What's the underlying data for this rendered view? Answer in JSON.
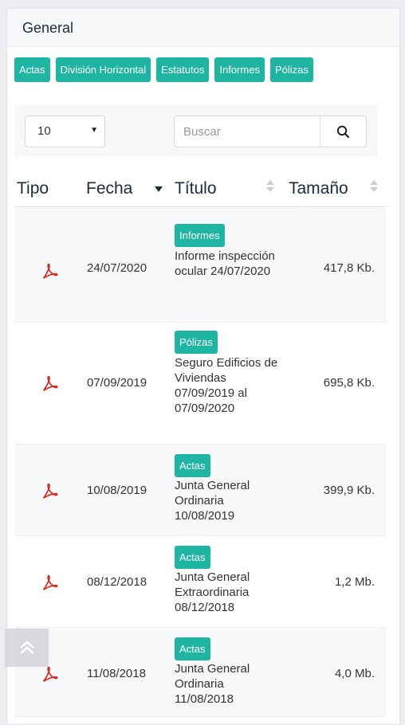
{
  "panel": {
    "title": "General"
  },
  "tags": [
    "Actas",
    "División Horizontal",
    "Estatutos",
    "Informes",
    "Pólizas"
  ],
  "toolbar": {
    "page_size": "10",
    "search_placeholder": "Buscar"
  },
  "table": {
    "columns": [
      "Tipo",
      "Fecha",
      "Título",
      "Tamaño"
    ],
    "rows": [
      {
        "type": "pdf-icon",
        "date": "24/07/2020",
        "badge": "Informes",
        "title": "Informe inspección ocular 24/07/2020",
        "size": "417,8 Kb."
      },
      {
        "type": "pdf-icon",
        "date": "07/09/2019",
        "badge": "Pólizas",
        "title": "Seguro Edificios de Viviendas 07/09/2019 al 07/09/2020",
        "size": "695,8 Kb."
      },
      {
        "type": "pdf-icon",
        "date": "10/08/2019",
        "badge": "Actas",
        "title": "Junta General Ordinaria 10/08/2019",
        "size": "399,9 Kb."
      },
      {
        "type": "pdf-icon",
        "date": "08/12/2018",
        "badge": "Actas",
        "title": "Junta General Extraordinaria 08/12/2018",
        "size": "1,2 Mb."
      },
      {
        "type": "pdf-icon",
        "date": "11/08/2018",
        "badge": "Actas",
        "title": "Junta General Ordinaria 11/08/2018",
        "size": "4,0 Mb."
      }
    ]
  },
  "colors": {
    "accent": "#1fb5a3",
    "pdf_red": "#e2231a",
    "text": "#1c2a3b"
  },
  "icons": {
    "search": "search-icon",
    "back_to_top": "double-chevron-up-icon"
  }
}
